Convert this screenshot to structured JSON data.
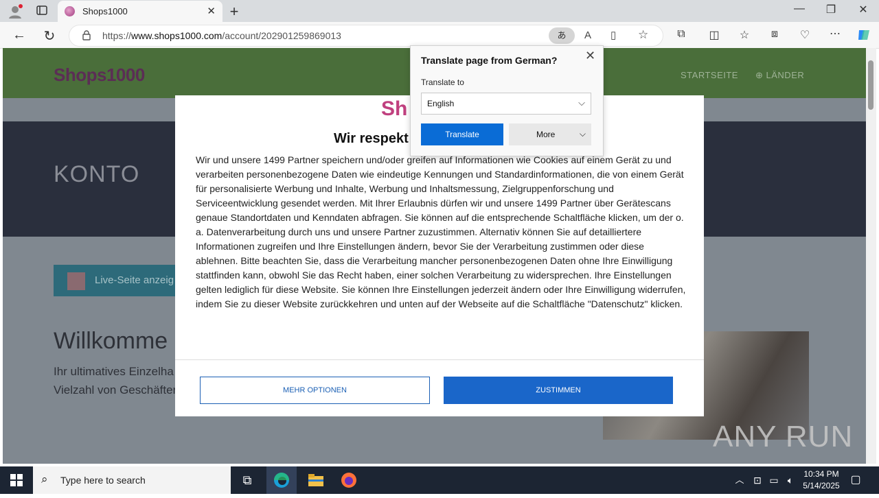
{
  "browser": {
    "tab_title": "Shops1000",
    "url_prefix": "https://",
    "url_domain": "www.shops1000.com",
    "url_path": "/account/202901259869013",
    "icons": [
      "profile-icon",
      "tab-actions-icon",
      "refresh-icon",
      "back-icon",
      "lock-icon",
      "translate-icon",
      "read-aloud-icon",
      "immersive-reader-icon",
      "favorite-star-icon",
      "extensions-icon",
      "split-screen-icon",
      "favorites-icon",
      "collections-icon",
      "browser-essentials-icon",
      "more-icon",
      "copilot-icon"
    ]
  },
  "site": {
    "logo": "Shops1000",
    "nav": [
      "STARTSEITE",
      "LÄNDER"
    ],
    "hero_title": "KONTO",
    "live_button": "Live-Seite anzeig",
    "welcome": "Willkomme",
    "welcome_sub_1": "Ihr ultimatives Einzelha",
    "welcome_sub_2": "Vielzahl von Geschäfter"
  },
  "consent": {
    "logo": "Sh",
    "title": "Wir respekt",
    "body": "Wir und unsere 1499 Partner speichern und/oder greifen auf Informationen wie Cookies auf einem Gerät zu und verarbeiten personenbezogene Daten wie eindeutige Kennungen und Standardinformationen, die von einem Gerät für personalisierte Werbung und Inhalte, Werbung und Inhaltsmessung, Zielgruppenforschung und Serviceentwicklung gesendet werden. Mit Ihrer Erlaubnis dürfen wir und unsere 1499 Partner über Gerätescans genaue Standortdaten und Kenndaten abfragen. Sie können auf die entsprechende Schaltfläche klicken, um der o. a. Datenverarbeitung durch uns und unsere Partner zuzustimmen. Alternativ können Sie auf detailliertere Informationen zugreifen und Ihre Einstellungen ändern, bevor Sie der Verarbeitung zustimmen oder diese ablehnen. Bitte beachten Sie, dass die Verarbeitung mancher personenbezogenen Daten ohne Ihre Einwilligung stattfinden kann, obwohl Sie das Recht haben, einer solchen Verarbeitung zu widersprechen. Ihre Einstellungen gelten lediglich für diese Website. Sie können Ihre Einstellungen jederzeit ändern oder Ihre Einwilligung widerrufen, indem Sie zu dieser Website zurückkehren und unten auf der Webseite auf die Schaltfläche \"Datenschutz\" klicken.",
    "more_options": "MEHR OPTIONEN",
    "agree": "ZUSTIMMEN"
  },
  "translate_popup": {
    "title": "Translate page from German?",
    "label": "Translate to",
    "selected_language": "English",
    "translate_button": "Translate",
    "more_button": "More"
  },
  "watermark": "ANY RUN",
  "taskbar": {
    "search_placeholder": "Type here to search",
    "time": "10:34 PM",
    "date": "5/14/2025"
  }
}
